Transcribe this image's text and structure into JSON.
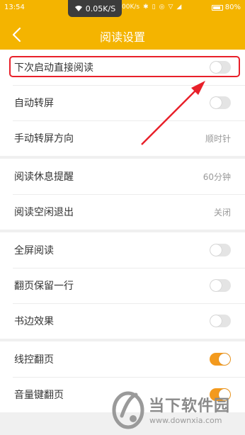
{
  "status_bar": {
    "time": "13:54",
    "speed": "0.05K/S",
    "right_speed": "00K/s",
    "battery": "80%"
  },
  "header": {
    "title": "阅读设置"
  },
  "groups": [
    {
      "rows": [
        {
          "label": "下次启动直接阅读",
          "control": "toggle",
          "state": "off"
        },
        {
          "label": "自动转屏",
          "control": "toggle",
          "state": "off"
        },
        {
          "label": "手动转屏方向",
          "control": "value",
          "value": "顺时针"
        }
      ]
    },
    {
      "rows": [
        {
          "label": "阅读休息提醒",
          "control": "value",
          "value": "60分钟"
        },
        {
          "label": "阅读空闲退出",
          "control": "value",
          "value": "关闭"
        }
      ]
    },
    {
      "rows": [
        {
          "label": "全屏阅读",
          "control": "toggle",
          "state": "off"
        },
        {
          "label": "翻页保留一行",
          "control": "toggle",
          "state": "off"
        },
        {
          "label": "书边效果",
          "control": "toggle",
          "state": "off"
        }
      ]
    },
    {
      "rows": [
        {
          "label": "线控翻页",
          "control": "toggle",
          "state": "on"
        },
        {
          "label": "音量键翻页",
          "control": "toggle",
          "state": "on"
        }
      ]
    }
  ],
  "watermark": {
    "text": "当下软件园",
    "url": "www.downxia.com"
  },
  "colors": {
    "accent": "#f4b400",
    "toggle_on": "#f39a1e",
    "annotation": "#e8202a"
  }
}
